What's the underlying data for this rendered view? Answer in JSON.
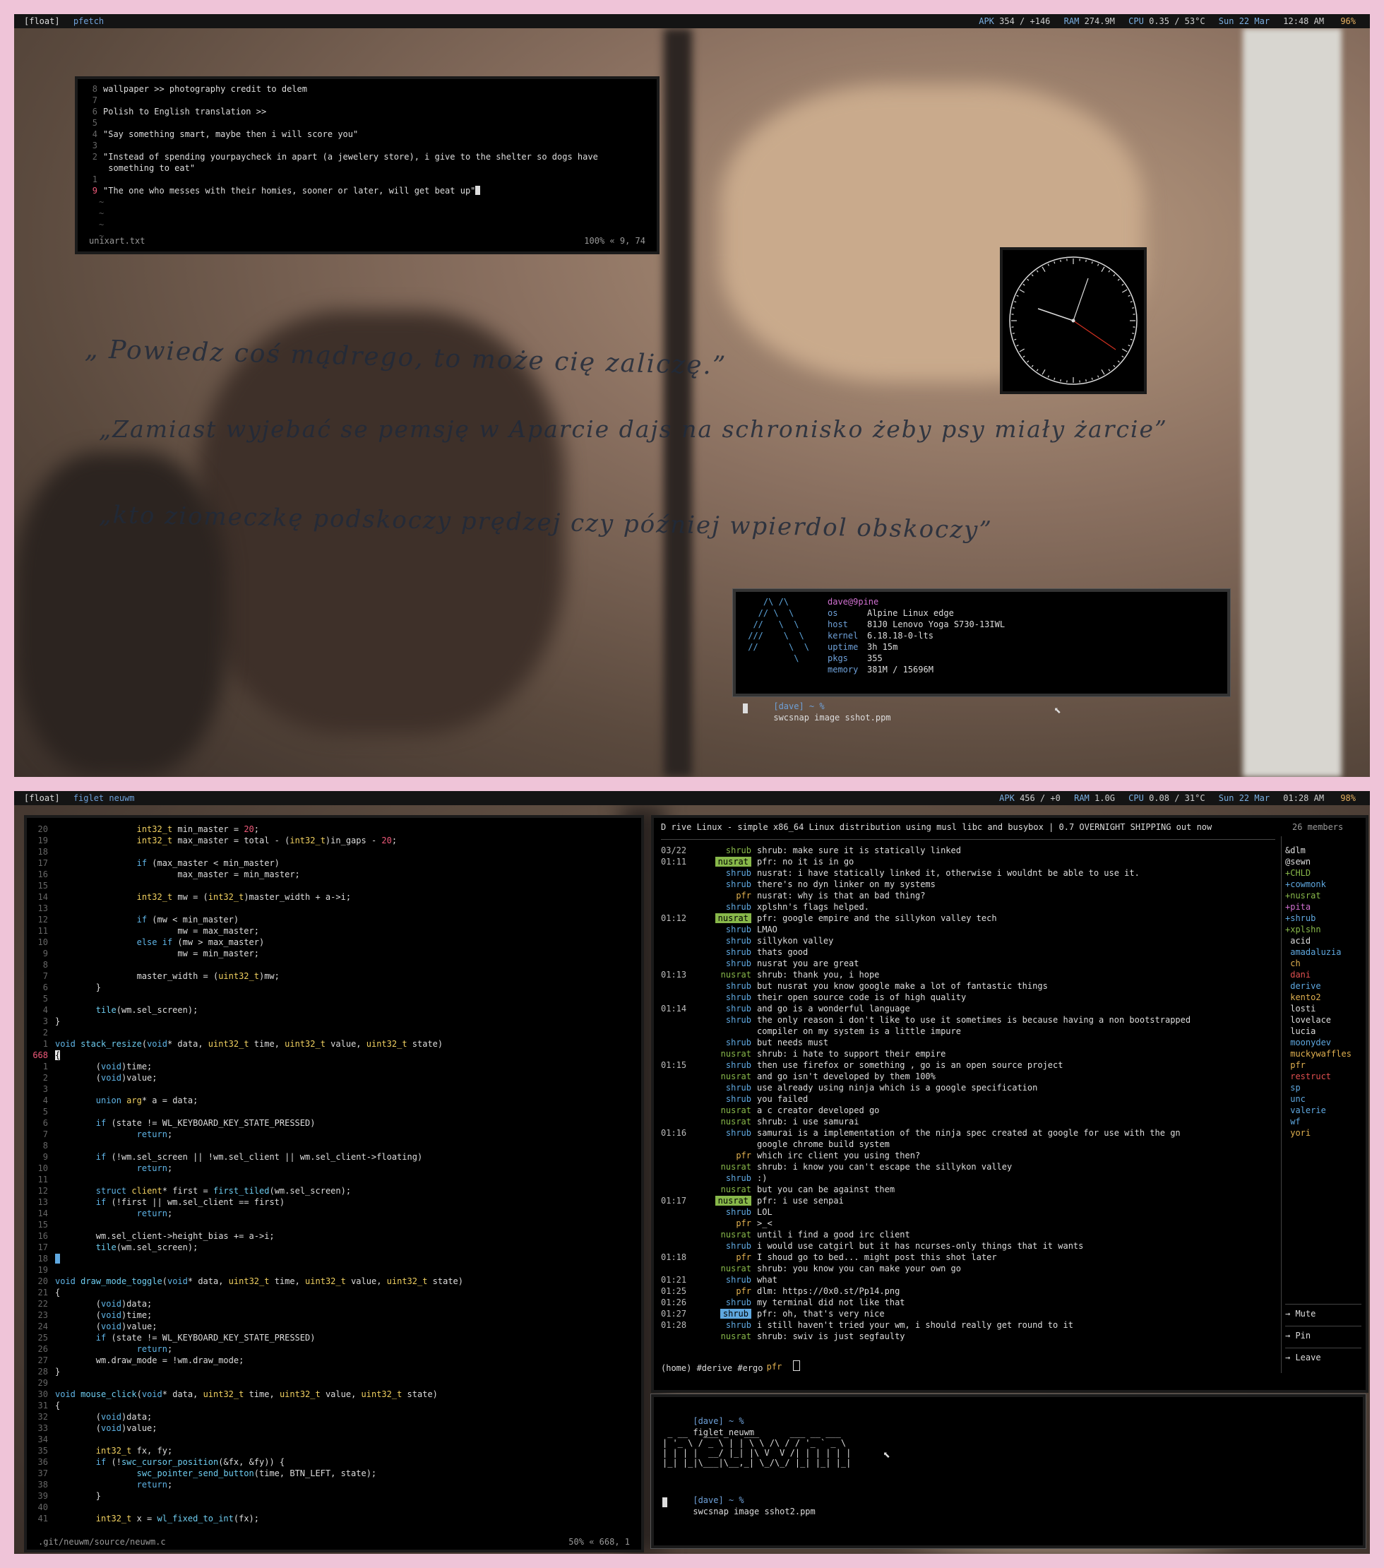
{
  "top": {
    "bar": {
      "tag": "[float]",
      "title": "pfetch",
      "apk_label": "APK",
      "apk_value": "354 / +146",
      "ram_label": "RAM",
      "ram_value": "274.9M",
      "cpu_label": "CPU",
      "cpu_value": "0.35 / 53°C",
      "date": "Sun 22 Mar",
      "time": "12:48 AM",
      "battery": "96%"
    },
    "editor": {
      "lines": [
        {
          "num": "8",
          "text": "wallpaper >> photography credit to delem"
        },
        {
          "num": "7",
          "text": ""
        },
        {
          "num": "6",
          "text": "Polish to English translation >>"
        },
        {
          "num": "5",
          "text": ""
        },
        {
          "num": "4",
          "text": "\"Say something smart, maybe then i will score you\""
        },
        {
          "num": "3",
          "text": ""
        },
        {
          "num": "2",
          "text": "\"Instead of spending yourpaycheck in apart (a jewelery store), i give to the shelter so dogs have"
        },
        {
          "num": "",
          "text": " something to eat\""
        },
        {
          "num": "1",
          "text": ""
        },
        {
          "num": "9",
          "text": "\"The one who messes with their homies, sooner or later, will get beat up\""
        }
      ],
      "filename": "unixart.txt",
      "position": "100% « 9, 74"
    },
    "handwriting": [
      "„ Powiedz coś mądrego, to może cię zaliczę.”",
      "„Zamiast wyjebać se pemsję w Aparcie dajs na schronisko żeby psy miały żarcie”",
      "„kto ziomeczkę podskoczy prędzej czy później wpierdol obskoczy”"
    ],
    "fetch": {
      "userhost": "dave@9pine",
      "rows": [
        {
          "k": "os",
          "v": "Alpine Linux edge"
        },
        {
          "k": "host",
          "v": "81J0 Lenovo Yoga S730-13IWL"
        },
        {
          "k": "kernel",
          "v": "6.18.18-0-lts"
        },
        {
          "k": "uptime",
          "v": "3h 15m"
        },
        {
          "k": "pkgs",
          "v": "355"
        },
        {
          "k": "memory",
          "v": "381M / 15696M"
        }
      ],
      "prompt": "[dave] ~ %",
      "command": "swcsnap image sshot.ppm"
    }
  },
  "bottom": {
    "bar": {
      "tag": "[float]",
      "title": "figlet neuwm",
      "apk_label": "APK",
      "apk_value": "456 / +0",
      "ram_label": "RAM",
      "ram_value": "1.0G",
      "cpu_label": "CPU",
      "cpu_value": "0.08 / 31°C",
      "date": "Sun 22 Mar",
      "time": "01:28 AM",
      "battery": "98%"
    },
    "code": {
      "filename": ".git/neuwm/source/neuwm.c",
      "position": "50% « 668, 1"
    },
    "chat": {
      "topic": "D rive Linux - simple x86_64 Linux distribution using musl libc and busybox | 0.7 OVERNIGHT SHIPPING out now",
      "members_count": "26 members",
      "messages": [
        {
          "t": "03/22",
          "n": "shrub",
          "c": "nusrat",
          "m": "shrub: make sure it is statically linked"
        },
        {
          "t": "01:11",
          "n": "nusrat",
          "c": "hl",
          "m": "pfr: no it is in go"
        },
        {
          "t": "",
          "n": "shrub",
          "c": "shrub",
          "m": "nusrat: i have statically linked it, otherwise i wouldnt be able to use it."
        },
        {
          "t": "",
          "n": "shrub",
          "c": "shrub",
          "m": "there's no dyn linker on my systems"
        },
        {
          "t": "",
          "n": "pfr",
          "c": "pfr",
          "m": "nusrat: why is that an bad thing?"
        },
        {
          "t": "",
          "n": "shrub",
          "c": "shrub",
          "m": "xplshn's flags helped."
        },
        {
          "t": "01:12",
          "n": "nusrat",
          "c": "hl",
          "m": "pfr: google empire and the sillykon valley tech"
        },
        {
          "t": "",
          "n": "shrub",
          "c": "shrub",
          "m": "LMAO"
        },
        {
          "t": "",
          "n": "shrub",
          "c": "shrub",
          "m": "sillykon valley"
        },
        {
          "t": "",
          "n": "shrub",
          "c": "shrub",
          "m": "thats good"
        },
        {
          "t": "",
          "n": "shrub",
          "c": "shrub",
          "m": "nusrat you are great"
        },
        {
          "t": "01:13",
          "n": "nusrat",
          "c": "nusrat",
          "m": "shrub: thank you, i hope"
        },
        {
          "t": "",
          "n": "shrub",
          "c": "shrub",
          "m": "but nusrat you know google make a lot of fantastic things"
        },
        {
          "t": "",
          "n": "shrub",
          "c": "shrub",
          "m": "their open source code is of high quality"
        },
        {
          "t": "01:14",
          "n": "shrub",
          "c": "shrub",
          "m": "and go is a wonderful language"
        },
        {
          "t": "",
          "n": "shrub",
          "c": "shrub",
          "m": "the only reason i don't like to use it sometimes is because having a non bootstrapped"
        },
        {
          "t": "",
          "n": "",
          "c": "shrub",
          "m": "compiler on my system is a little impure"
        },
        {
          "t": "",
          "n": "shrub",
          "c": "shrub",
          "m": "but needs must"
        },
        {
          "t": "",
          "n": "nusrat",
          "c": "nusrat",
          "m": "shrub: i hate to support their empire"
        },
        {
          "t": "01:15",
          "n": "shrub",
          "c": "shrub",
          "m": "then use firefox or something , go is an open source project"
        },
        {
          "t": "",
          "n": "nusrat",
          "c": "nusrat",
          "m": "and go isn't developed by them 100%"
        },
        {
          "t": "",
          "n": "shrub",
          "c": "shrub",
          "m": "use already using ninja which is a google specification"
        },
        {
          "t": "",
          "n": "shrub",
          "c": "shrub",
          "m": "you failed"
        },
        {
          "t": "",
          "n": "nusrat",
          "c": "nusrat",
          "m": "a c creator developed go"
        },
        {
          "t": "",
          "n": "nusrat",
          "c": "nusrat",
          "m": "shrub: i use samurai"
        },
        {
          "t": "01:16",
          "n": "shrub",
          "c": "shrub",
          "m": "samurai is a implementation of the ninja spec created at google for use with the gn"
        },
        {
          "t": "",
          "n": "",
          "c": "shrub",
          "m": "google chrome build system"
        },
        {
          "t": "",
          "n": "pfr",
          "c": "pfr",
          "m": "which irc client you using then?"
        },
        {
          "t": "",
          "n": "nusrat",
          "c": "nusrat",
          "m": "shrub: i know you can't escape the sillykon valley"
        },
        {
          "t": "",
          "n": "shrub",
          "c": "shrub",
          "m": ":)"
        },
        {
          "t": "",
          "n": "nusrat",
          "c": "nusrat",
          "m": "but you can be against them"
        },
        {
          "t": "01:17",
          "n": "nusrat",
          "c": "hl",
          "m": "pfr: i use senpai"
        },
        {
          "t": "",
          "n": "shrub",
          "c": "shrub",
          "m": "LOL"
        },
        {
          "t": "",
          "n": "pfr",
          "c": "pfr",
          "m": ">_<"
        },
        {
          "t": "",
          "n": "nusrat",
          "c": "nusrat",
          "m": "until i find a good irc client"
        },
        {
          "t": "",
          "n": "shrub",
          "c": "shrub",
          "m": "i would use catgirl but it has ncurses-only things that it wants"
        },
        {
          "t": "01:18",
          "n": "pfr",
          "c": "pfr",
          "m": "I shoud go to bed... might post this shot later"
        },
        {
          "t": "",
          "n": "nusrat",
          "c": "nusrat",
          "m": "shrub: you know you can make your own go"
        },
        {
          "t": "01:21",
          "n": "shrub",
          "c": "shrub",
          "m": "what"
        },
        {
          "t": "01:25",
          "n": "pfr",
          "c": "pfr",
          "m": "dlm: https://0x0.st/Pp14.png"
        },
        {
          "t": "01:26",
          "n": "shrub",
          "c": "shrub",
          "m": "my terminal did not like that"
        },
        {
          "t": "01:27",
          "n": "shrub",
          "c": "hlb",
          "m": "pfr: oh, that's very nice"
        },
        {
          "t": "01:28",
          "n": "shrub",
          "c": "shrub",
          "m": "i still haven't tried your wm, i should really get round to it"
        },
        {
          "t": "",
          "n": "nusrat",
          "c": "nusrat",
          "m": "shrub: swiv is just segfaulty"
        }
      ],
      "input_nick": "pfr",
      "footer": "(home) #derive #ergo",
      "members": [
        {
          "n": "&dlm",
          "c": "#ddd"
        },
        {
          "n": "@sewn",
          "c": "#ddd"
        },
        {
          "n": "+CHLD",
          "c": "#88b84a"
        },
        {
          "n": "+cowmonk",
          "c": "#5fa8e0"
        },
        {
          "n": "+nusrat",
          "c": "#88b84a"
        },
        {
          "n": "+pita",
          "c": "#d070d0"
        },
        {
          "n": "+shrub",
          "c": "#5fa8e0"
        },
        {
          "n": "+xplshn",
          "c": "#88b84a"
        },
        {
          "n": " acid",
          "c": "#ddd"
        },
        {
          "n": " amadaluzia",
          "c": "#5fa8e0"
        },
        {
          "n": " ch",
          "c": "#e0b050"
        },
        {
          "n": " dani",
          "c": "#e05050"
        },
        {
          "n": " derive",
          "c": "#5fa8e0"
        },
        {
          "n": " kento2",
          "c": "#e0b050"
        },
        {
          "n": " losti",
          "c": "#ddd"
        },
        {
          "n": " lovelace",
          "c": "#ddd"
        },
        {
          "n": " lucia",
          "c": "#ddd"
        },
        {
          "n": " moonydev",
          "c": "#5fa8e0"
        },
        {
          "n": " muckywaffles",
          "c": "#e0b050"
        },
        {
          "n": " pfr",
          "c": "#e0b050"
        },
        {
          "n": " restruct",
          "c": "#e05050"
        },
        {
          "n": " sp",
          "c": "#5fa8e0"
        },
        {
          "n": " unc",
          "c": "#5fa8e0"
        },
        {
          "n": " valerie",
          "c": "#5fa8e0"
        },
        {
          "n": " wf",
          "c": "#5fa8e0"
        },
        {
          "n": " yori",
          "c": "#e0b050"
        }
      ],
      "actions": [
        "→ Mute",
        "→ Pin",
        "→ Leave"
      ]
    },
    "term": {
      "prompt": "[dave] ~ %",
      "command1": "figlet neuwm",
      "figlet": [
        " _ __   ___ _   ___      ___ __ ___  ",
        "| '_ \\ / _ \\ | | \\ \\ /\\ / / '_ ` _ \\ ",
        "| | | |  __/ |_| |\\ V  V /| | | | | |",
        "|_| |_|\\___|\\__,_| \\_/\\_/ |_| |_| |_|"
      ],
      "command2": "swcsnap image sshot2.ppm"
    }
  }
}
